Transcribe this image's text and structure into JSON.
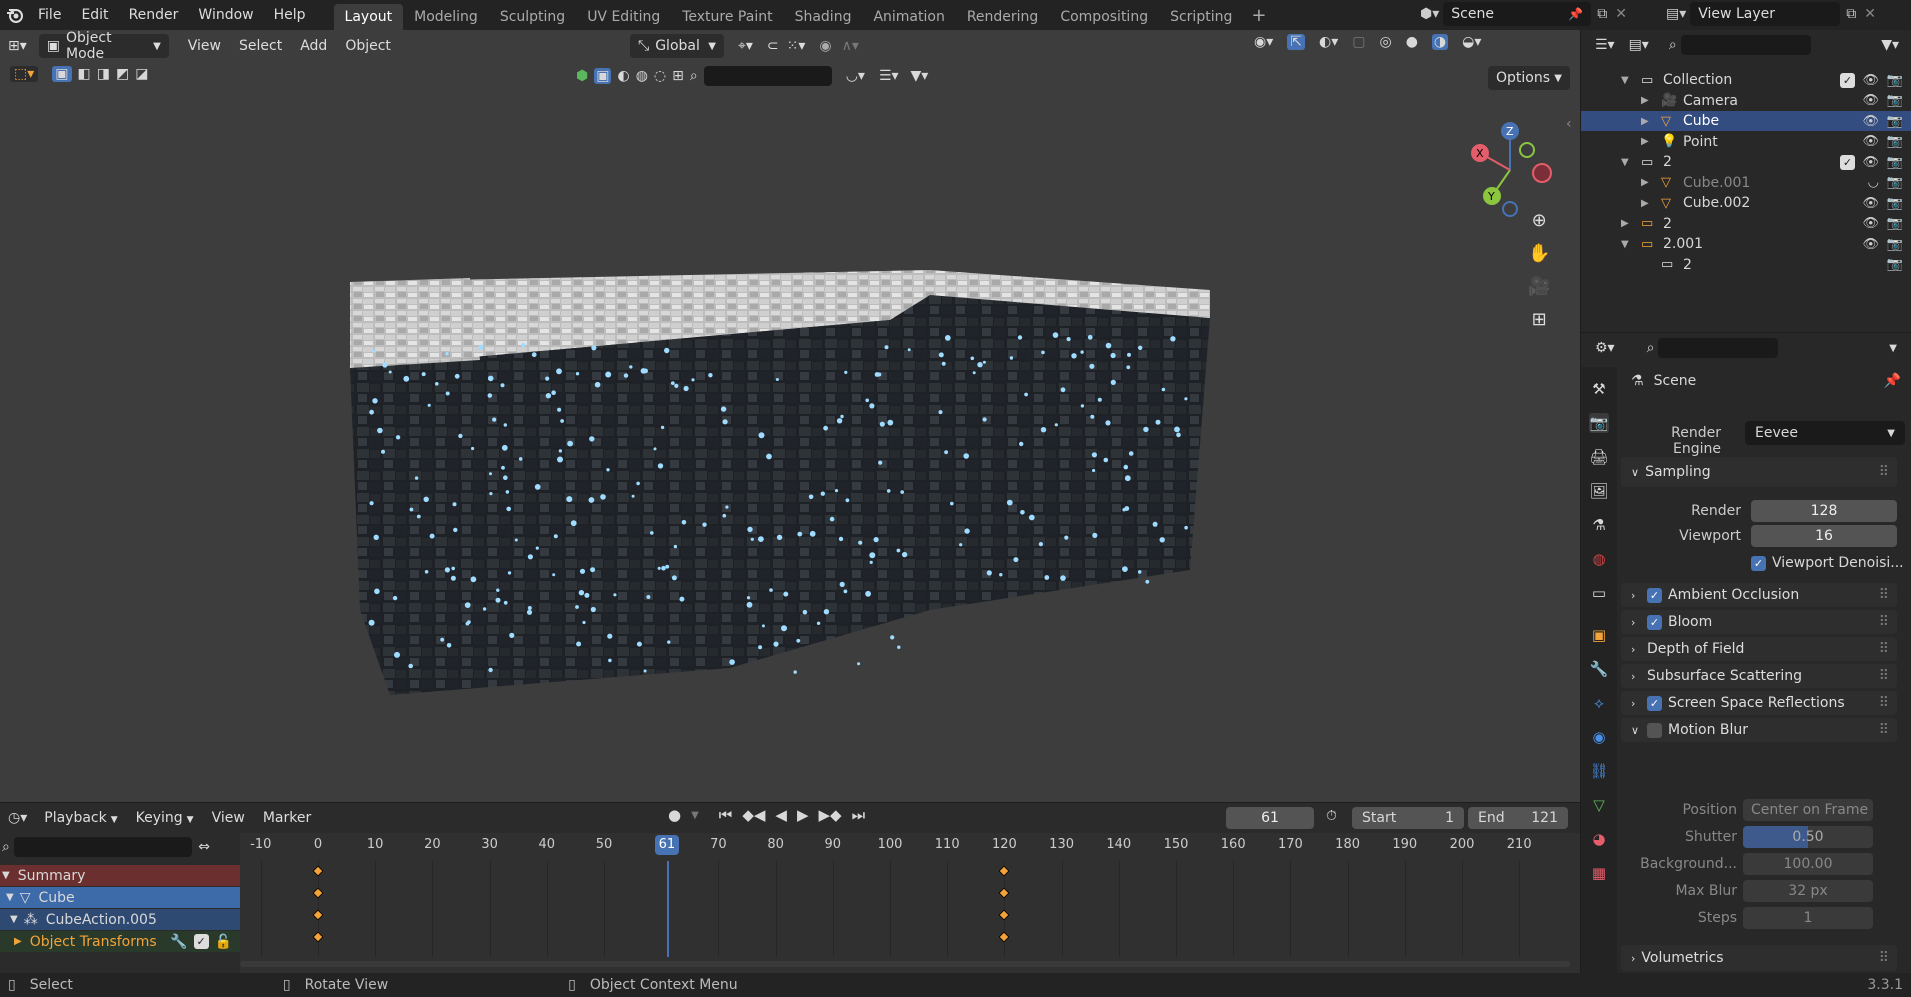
{
  "menu": {
    "file": "File",
    "edit": "Edit",
    "render": "Render",
    "window": "Window",
    "help": "Help"
  },
  "workspaces": [
    "Layout",
    "Modeling",
    "Sculpting",
    "UV Editing",
    "Texture Paint",
    "Shading",
    "Animation",
    "Rendering",
    "Compositing",
    "Scripting"
  ],
  "active_workspace": "Layout",
  "scene_name": "Scene",
  "view_layer": "View Layer",
  "viewport": {
    "mode": "Object Mode",
    "menus": [
      "View",
      "Select",
      "Add",
      "Object"
    ],
    "transform_orientation": "Global",
    "options_label": "Options"
  },
  "outliner": {
    "rows": [
      {
        "name": "Collection",
        "depth": 1,
        "type": "collection",
        "expanded": true,
        "checkbox": true
      },
      {
        "name": "Camera",
        "depth": 2,
        "type": "camera"
      },
      {
        "name": "Cube",
        "depth": 2,
        "type": "mesh",
        "selected": true
      },
      {
        "name": "Point",
        "depth": 2,
        "type": "light"
      },
      {
        "name": "2",
        "depth": 1,
        "type": "collection",
        "expanded": true,
        "checkbox": true
      },
      {
        "name": "Cube.001",
        "depth": 2,
        "type": "mesh",
        "dim": true
      },
      {
        "name": "Cube.002",
        "depth": 2,
        "type": "mesh"
      },
      {
        "name": "2",
        "depth": 1,
        "type": "collection_orange",
        "expanded": false
      },
      {
        "name": "2.001",
        "depth": 1,
        "type": "collection_orange",
        "expanded": true
      },
      {
        "name": "2",
        "depth": 2,
        "type": "collection_child"
      }
    ]
  },
  "properties": {
    "context": "Scene",
    "render_engine_label": "Render Engine",
    "render_engine": "Eevee",
    "sampling": {
      "title": "Sampling",
      "render_label": "Render",
      "render": "128",
      "viewport_label": "Viewport",
      "viewport": "16",
      "denoise_label": "Viewport Denoisi..."
    },
    "panels": [
      {
        "title": "Ambient Occlusion",
        "checkbox": true,
        "checked": true
      },
      {
        "title": "Bloom",
        "checkbox": true,
        "checked": true
      },
      {
        "title": "Depth of Field",
        "checkbox": false
      },
      {
        "title": "Subsurface Scattering",
        "checkbox": false
      },
      {
        "title": "Screen Space Reflections",
        "checkbox": true,
        "checked": true
      },
      {
        "title": "Motion Blur",
        "checkbox": true,
        "checked": false,
        "expanded": true
      }
    ],
    "motion_blur": {
      "position_label": "Position",
      "position": "Center on Frame",
      "shutter_label": "Shutter",
      "shutter": "0.50",
      "shutter_fill": 0.5,
      "background_label": "Background...",
      "background": "100.00",
      "max_blur_label": "Max Blur",
      "max_blur": "32 px",
      "steps_label": "Steps",
      "steps": "1"
    },
    "volumetrics": "Volumetrics"
  },
  "timeline": {
    "menus": [
      "Playback",
      "Keying",
      "View",
      "Marker"
    ],
    "current_frame": "61",
    "start_label": "Start",
    "start": "1",
    "end_label": "End",
    "end": "121",
    "ticks": [
      "-10",
      "0",
      "10",
      "20",
      "30",
      "40",
      "50",
      "70",
      "80",
      "90",
      "100",
      "110",
      "120",
      "130",
      "140",
      "150",
      "160",
      "170",
      "180",
      "190",
      "200",
      "210"
    ],
    "playhead_label": "61",
    "channels": [
      {
        "name": "Summary",
        "style": "summary"
      },
      {
        "name": "Cube",
        "style": "object"
      },
      {
        "name": "CubeAction.005",
        "style": "action"
      },
      {
        "name": "Object Transforms",
        "style": "group"
      }
    ],
    "keyframes_at": [
      0,
      120
    ]
  },
  "statusbar": {
    "select": "Select",
    "rotate": "Rotate View",
    "context": "Object Context Menu",
    "version": "3.3.1"
  },
  "colors": {
    "accent": "#4772b3",
    "selected_row": "#334d80",
    "keyframe": "#f2a33a",
    "summary": "#7a3a3a"
  }
}
